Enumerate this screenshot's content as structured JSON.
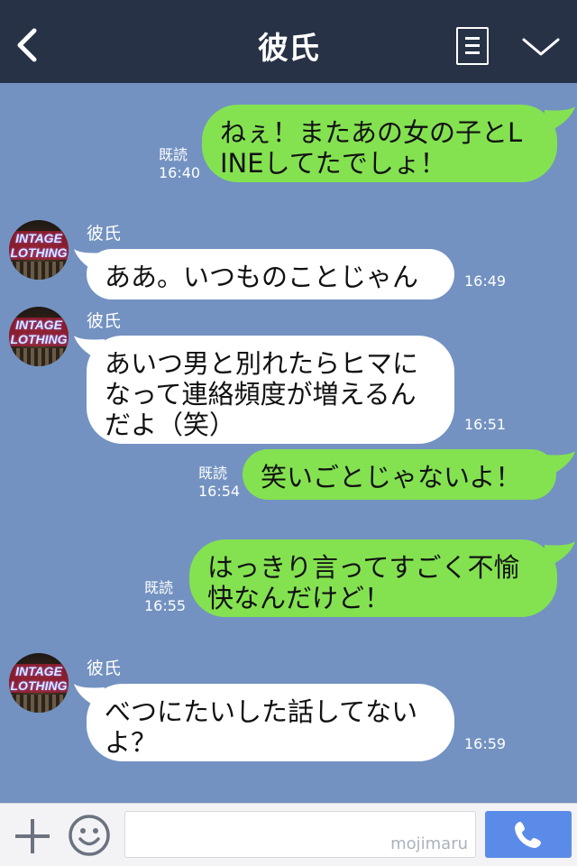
{
  "header": {
    "title": "彼氏",
    "icons": {
      "back": "chevron-left-icon",
      "menu": "menu-icon",
      "collapse": "chevron-down-icon"
    }
  },
  "colors": {
    "header_bg": "#273246",
    "chat_bg": "#7392c1",
    "outgoing_bubble": "#84e251",
    "incoming_bubble": "#ffffff",
    "send_button": "#5b8be8"
  },
  "messages": [
    {
      "direction": "out",
      "lines": [
        "ねぇ！またあの女の子とL",
        "INEしてたでしょ！"
      ],
      "read_label": "既読",
      "time": "16:40"
    },
    {
      "direction": "in",
      "sender": "彼氏",
      "avatar_text": [
        "INTAGE",
        "LOTHING"
      ],
      "lines": [
        "ああ。いつものことじゃん"
      ],
      "time": "16:49"
    },
    {
      "direction": "in",
      "sender": "彼氏",
      "avatar_text": [
        "INTAGE",
        "LOTHING"
      ],
      "lines": [
        "あいつ男と別れたらヒマに",
        "なって連絡頻度が増えるん",
        "だよ（笑）"
      ],
      "time": "16:51"
    },
    {
      "direction": "out",
      "lines": [
        "笑いごとじゃないよ！"
      ],
      "read_label": "既読",
      "time": "16:54"
    },
    {
      "direction": "out",
      "lines": [
        "はっきり言ってすごく不愉",
        "快なんだけど！"
      ],
      "read_label": "既読",
      "time": "16:55"
    },
    {
      "direction": "in",
      "sender": "彼氏",
      "avatar_text": [
        "INTAGE",
        "LOTHING"
      ],
      "lines": [
        "べつにたいした話してない",
        "よ？"
      ],
      "time": "16:59"
    }
  ],
  "input_bar": {
    "watermark": "mojimaru",
    "icons": {
      "plus": "plus-icon",
      "emoji": "emoji-icon",
      "call": "phone-icon"
    }
  }
}
